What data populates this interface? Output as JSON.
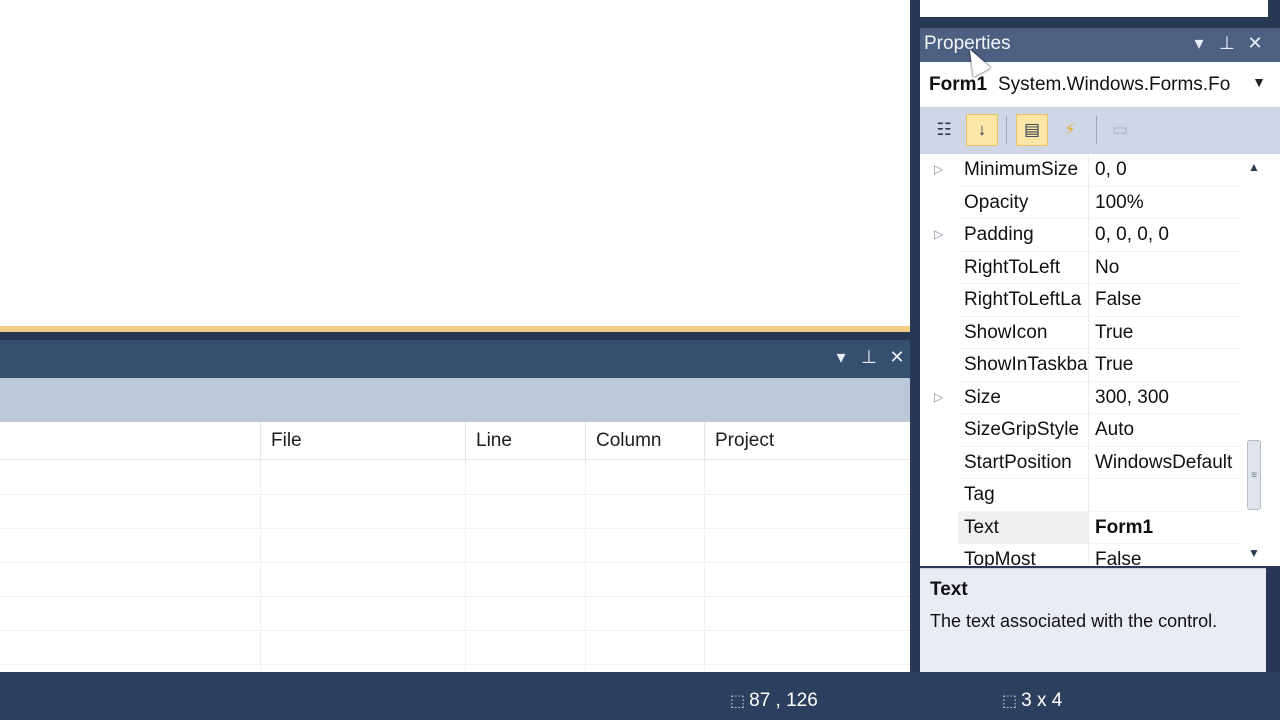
{
  "error_list": {
    "columns": [
      "File",
      "Line",
      "Column",
      "Project"
    ],
    "rows": 6
  },
  "properties": {
    "title": "Properties",
    "object_name": "Form1",
    "object_type": "System.Windows.Forms.Fo",
    "rows": [
      {
        "name": "MinimumSize",
        "value": "0, 0",
        "expandable": true
      },
      {
        "name": "Opacity",
        "value": "100%",
        "expandable": false
      },
      {
        "name": "Padding",
        "value": "0, 0, 0, 0",
        "expandable": true
      },
      {
        "name": "RightToLeft",
        "value": "No",
        "expandable": false
      },
      {
        "name": "RightToLeftLa",
        "value": "False",
        "expandable": false
      },
      {
        "name": "ShowIcon",
        "value": "True",
        "expandable": false
      },
      {
        "name": "ShowInTaskba",
        "value": "True",
        "expandable": false
      },
      {
        "name": "Size",
        "value": "300, 300",
        "expandable": true
      },
      {
        "name": "SizeGripStyle",
        "value": "Auto",
        "expandable": false
      },
      {
        "name": "StartPosition",
        "value": "WindowsDefault",
        "expandable": false
      },
      {
        "name": "Tag",
        "value": "",
        "expandable": false
      },
      {
        "name": "Text",
        "value": "Form1",
        "expandable": false,
        "selected": true
      },
      {
        "name": "TopMost",
        "value": "False",
        "expandable": false
      }
    ],
    "description": {
      "title": "Text",
      "text": "The text associated with the control."
    }
  },
  "status": {
    "position": "87 , 126",
    "size": "3 x 4"
  },
  "icons": {
    "dropdown": "chevron-down-icon",
    "pin": "pin-icon",
    "close": "close-icon",
    "categorized": "categorized-icon",
    "alphabetical": "alphabetical-icon",
    "properties_view": "properties-icon",
    "events": "events-icon",
    "property_pages": "property-pages-icon"
  },
  "colors": {
    "accent_tab": "#f5cc84",
    "chrome_dark": "#293955",
    "active_tool": "#fbe6a8"
  }
}
